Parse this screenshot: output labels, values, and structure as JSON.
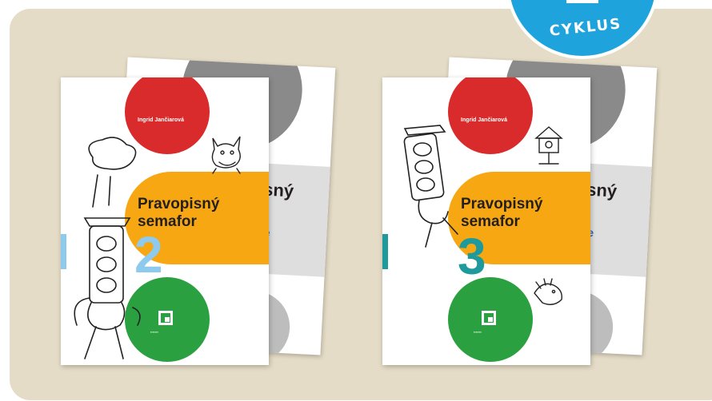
{
  "badge": {
    "text": "CYKLUS"
  },
  "books": {
    "left": {
      "back": {
        "title_line1_tail": "isný",
        "title_line2_tail": "r",
        "blue_word": "re"
      },
      "front": {
        "author": "Ingrid Jančiarová",
        "title_line1": "Pravopisný",
        "title_line2": "semafor",
        "number": "2"
      }
    },
    "right": {
      "back": {
        "title_line1_tail": "isný",
        "title_line2_tail": "r",
        "blue_word": "ore"
      },
      "front": {
        "author": "Ingrid Jančiarová",
        "title_line1": "Pravopisný",
        "title_line2": "semafor",
        "number": "3"
      }
    }
  },
  "colors": {
    "panel": "#e5dcc7",
    "badge": "#1fa3dd",
    "red": "#d92b2b",
    "orange": "#f6a711",
    "green": "#2aa040",
    "grey": "#8a8a8a",
    "light_grey": "#dedede",
    "number_2": "#8ec9ee",
    "number_3": "#1f9a9c"
  }
}
